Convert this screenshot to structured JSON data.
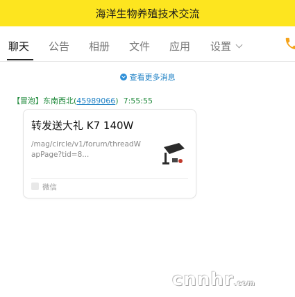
{
  "window": {
    "title": "海洋生物养殖技术交流"
  },
  "tabs": [
    {
      "label": "聊天",
      "active": true
    },
    {
      "label": "公告"
    },
    {
      "label": "相册"
    },
    {
      "label": "文件"
    },
    {
      "label": "应用"
    },
    {
      "label": "设置"
    }
  ],
  "icons": {
    "settings_dropdown": "chevron-down-icon",
    "call": "phone-icon",
    "more": "arrow-circle-icon"
  },
  "chat": {
    "more_messages": "查看更多消息",
    "message": {
      "badge": "【冒泡】",
      "sender_name": "东南西北",
      "uid_open": "(",
      "sender_id": "45989066",
      "uid_close": ")",
      "time": "7:55:55",
      "card": {
        "title": "转发送大礼 K7 140W",
        "description": "/mag/circle/v1/forum/threadWapPage?tid=8...",
        "source": "微信"
      }
    }
  },
  "watermark": {
    "main": "cnnhr",
    "suffix": ".com"
  },
  "colors": {
    "title_bar": "#fde51f",
    "sender": "#208a3c",
    "link": "#1b7fc4",
    "call": "#f5a31a"
  }
}
